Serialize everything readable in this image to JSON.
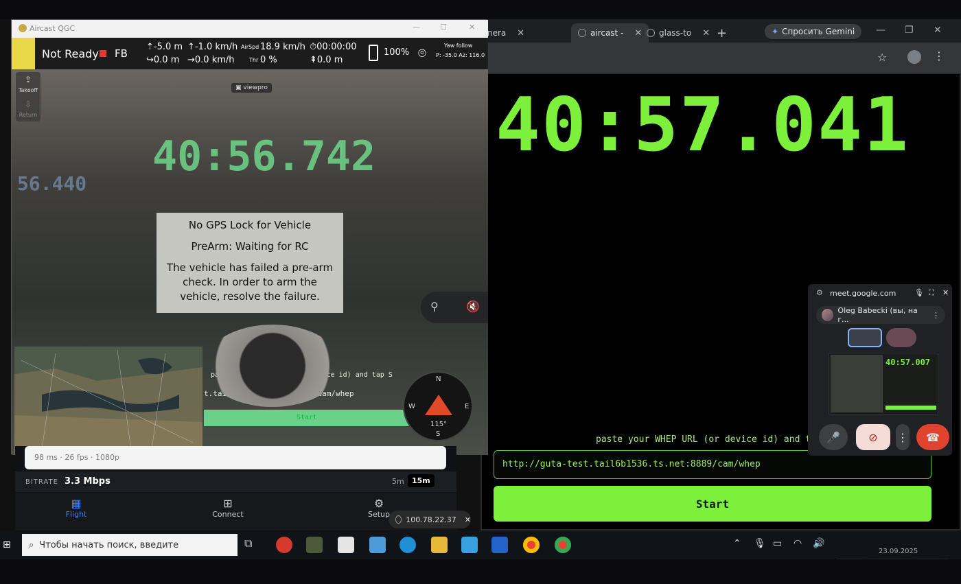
{
  "qgc": {
    "window_title": "Aircast QGC",
    "status": "Not Ready",
    "mode": "FB",
    "alt_rel": "-5.0 m",
    "climb": "-1.0 km/h",
    "alt_amsl": "0.0 m",
    "ground_speed": "0.0 km/h",
    "airspeed_label": "AirSpd",
    "airspeed": "18.9 km/h",
    "throttle_label": "Thr",
    "throttle": "0 %",
    "flight_time": "00:00:00",
    "distance": "0.0 m",
    "battery": "100%",
    "gimbal_mode": "Yaw follow",
    "gimbal_angles": "P: -35.0 Az: 116.0",
    "takeoff_label": "Takeoff",
    "return_label": "Return",
    "camera_tag": "viewpro",
    "messages": [
      "No GPS Lock for Vehicle",
      "PreArm: Waiting for RC",
      "The vehicle has failed a pre-arm check. In order to arm the vehicle, resolve the failure."
    ],
    "compass": {
      "n": "N",
      "s": "S",
      "e": "E",
      "w": "W",
      "heading": "115°"
    },
    "video_clock": "40:56.742",
    "video_clock_bg": "56.440",
    "video_prompt": "paste your WHEP URL (or device id) and tap S",
    "video_url": "t.tail6b1536.ts.net:8889/cam/whep",
    "video_start": "Start"
  },
  "aircast": {
    "stream_stats": "98 ms · 26 fps · 1080p",
    "bitrate_label": "BITRATE",
    "bitrate_value": "3.3 Mbps",
    "range_5m": "5m",
    "range_15m": "15m",
    "nav": [
      {
        "label": "Flight",
        "active": true
      },
      {
        "label": "Connect",
        "active": false
      },
      {
        "label": "Setup",
        "active": false
      }
    ]
  },
  "ip_pill": "100.78.22.37",
  "chrome": {
    "tabs": [
      {
        "label": "nera",
        "active": false
      },
      {
        "label": "aircast -",
        "active": true
      },
      {
        "label": "glass-to",
        "active": false
      }
    ],
    "gemini_label": "Спросить Gemini",
    "big_clock": "40:57.041",
    "whep_prompt": "paste your WHEP URL (or device id) and tap S",
    "whep_url": "http://guta-test.tail6b1536.ts.net:8889/cam/whep",
    "start_label": "Start"
  },
  "meet": {
    "domain": "meet.google.com",
    "user_label": "Oleg Babecki (вы, на г...",
    "preview_clock": "40:57.007"
  },
  "taskbar": {
    "search_placeholder": "Чтобы начать поиск, введите",
    "date": "23.09.2025"
  },
  "colors": {
    "neon_green": "#7cf03a",
    "aircast_blue": "#3b82f6",
    "hangup_red": "#e0442f"
  }
}
